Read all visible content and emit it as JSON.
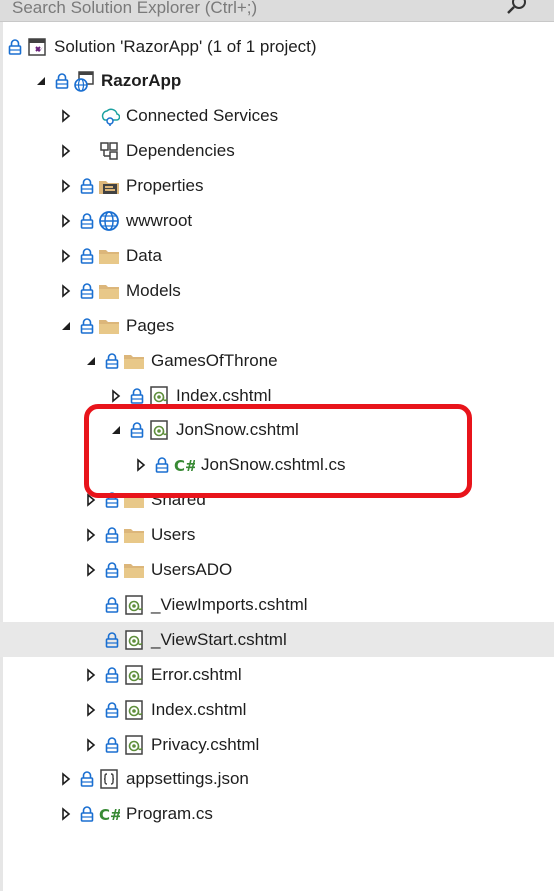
{
  "search": {
    "placeholder": "Search Solution Explorer (Ctrl+;)"
  },
  "tree": [
    {
      "label": "Solution 'RazorApp' (1 of 1 project)",
      "icon": "solution-icon",
      "expander": "none",
      "lock": true,
      "bold": false,
      "indent": 0
    },
    {
      "label": "RazorApp",
      "icon": "web-project-icon",
      "expander": "expanded",
      "lock": true,
      "bold": true,
      "indent": 1
    },
    {
      "label": "Connected Services",
      "icon": "connected-services-icon",
      "expander": "collapsed",
      "lock": false,
      "bold": false,
      "indent": 2
    },
    {
      "label": "Dependencies",
      "icon": "dependencies-icon",
      "expander": "collapsed",
      "lock": false,
      "bold": false,
      "indent": 2
    },
    {
      "label": "Properties",
      "icon": "properties-icon",
      "expander": "collapsed",
      "lock": true,
      "bold": false,
      "indent": 2
    },
    {
      "label": "wwwroot",
      "icon": "globe-icon",
      "expander": "collapsed",
      "lock": true,
      "bold": false,
      "indent": 2
    },
    {
      "label": "Data",
      "icon": "folder-icon",
      "expander": "collapsed",
      "lock": true,
      "bold": false,
      "indent": 2
    },
    {
      "label": "Models",
      "icon": "folder-icon",
      "expander": "collapsed",
      "lock": true,
      "bold": false,
      "indent": 2
    },
    {
      "label": "Pages",
      "icon": "folder-icon",
      "expander": "expanded",
      "lock": true,
      "bold": false,
      "indent": 2
    },
    {
      "label": "GamesOfThrone",
      "icon": "folder-icon",
      "expander": "expanded",
      "lock": true,
      "bold": false,
      "indent": 3
    },
    {
      "label": "Index.cshtml",
      "icon": "razor-file-icon",
      "expander": "collapsed",
      "lock": true,
      "bold": false,
      "indent": 4
    },
    {
      "label": "JonSnow.cshtml",
      "icon": "razor-file-icon",
      "expander": "expanded",
      "lock": true,
      "bold": false,
      "indent": 4
    },
    {
      "label": "JonSnow.cshtml.cs",
      "icon": "csharp-file-icon",
      "expander": "collapsed",
      "lock": true,
      "bold": false,
      "indent": 5
    },
    {
      "label": "Shared",
      "icon": "folder-icon",
      "expander": "collapsed",
      "lock": true,
      "bold": false,
      "indent": 3
    },
    {
      "label": "Users",
      "icon": "folder-icon",
      "expander": "collapsed",
      "lock": true,
      "bold": false,
      "indent": 3
    },
    {
      "label": "UsersADO",
      "icon": "folder-icon",
      "expander": "collapsed",
      "lock": true,
      "bold": false,
      "indent": 3
    },
    {
      "label": "_ViewImports.cshtml",
      "icon": "razor-file-icon",
      "expander": "none",
      "lock": true,
      "bold": false,
      "indent": 3
    },
    {
      "label": "_ViewStart.cshtml",
      "icon": "razor-file-icon",
      "expander": "none",
      "lock": true,
      "bold": false,
      "indent": 3,
      "selected": true
    },
    {
      "label": "Error.cshtml",
      "icon": "razor-file-icon",
      "expander": "collapsed",
      "lock": true,
      "bold": false,
      "indent": 3
    },
    {
      "label": "Index.cshtml",
      "icon": "razor-file-icon",
      "expander": "collapsed",
      "lock": true,
      "bold": false,
      "indent": 3
    },
    {
      "label": "Privacy.cshtml",
      "icon": "razor-file-icon",
      "expander": "collapsed",
      "lock": true,
      "bold": false,
      "indent": 3
    },
    {
      "label": "appsettings.json",
      "icon": "json-file-icon",
      "expander": "collapsed",
      "lock": true,
      "bold": false,
      "indent": 2
    },
    {
      "label": "Program.cs",
      "icon": "csharp-file-icon",
      "expander": "collapsed",
      "lock": true,
      "bold": false,
      "indent": 2
    }
  ],
  "colors": {
    "highlight": "#e8141b",
    "folder": "#dcb67a",
    "lock": "#1a6fd1",
    "csharp": "#388a34",
    "razor": "#5f8f3c"
  }
}
